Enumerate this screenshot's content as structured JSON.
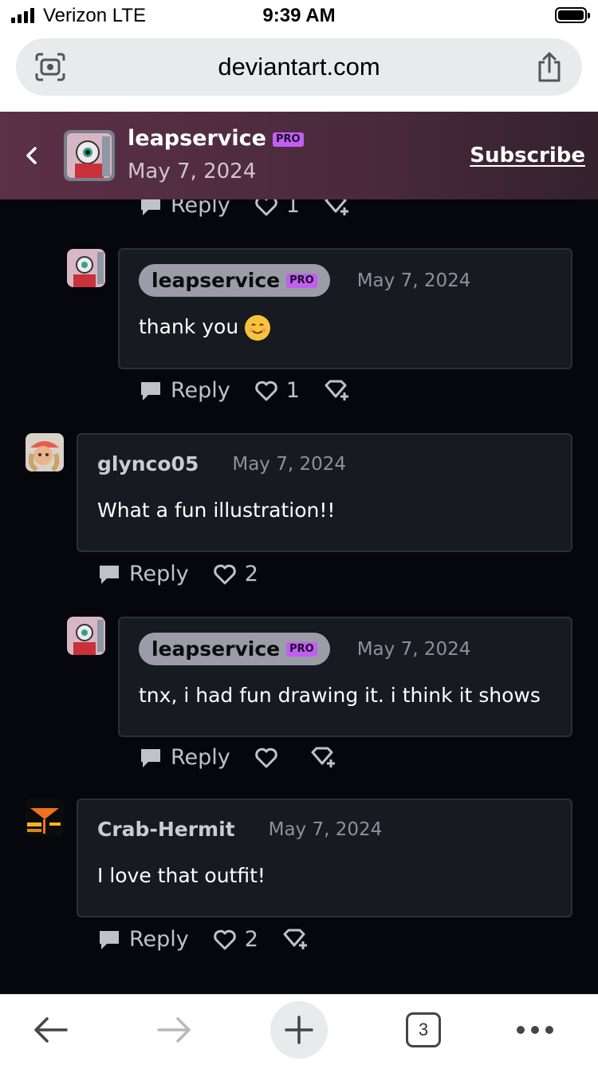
{
  "status_bar": {
    "carrier": "Verizon  LTE",
    "time": "9:39 AM"
  },
  "address_bar": {
    "url": "deviantart.com"
  },
  "deviation_header": {
    "username": "leapservice",
    "badge": "PRO",
    "date": "May 7, 2024",
    "subscribe_label": "Subscribe"
  },
  "top_actions": {
    "reply": "Reply",
    "likes": "1"
  },
  "comments": [
    {
      "username": "leapservice",
      "badge": "PRO",
      "date": "May 7, 2024",
      "text": "thank you",
      "reply": "Reply",
      "likes": "1"
    },
    {
      "username": "glynco05",
      "date": "May 7, 2024",
      "text": "What a fun illustration!!",
      "reply": "Reply",
      "likes": "2"
    },
    {
      "username": "leapservice",
      "badge": "PRO",
      "date": "May 7, 2024",
      "text": "tnx, i had fun drawing it. i think it shows",
      "reply": "Reply",
      "likes": ""
    },
    {
      "username": "Crab-Hermit",
      "date": "May 7, 2024",
      "text": "I love that outfit!",
      "reply": "Reply",
      "likes": "2"
    }
  ],
  "toolbar": {
    "tab_count": "3"
  },
  "colors": {
    "pro_badge": "#c15ff2",
    "header_bg": "#5c3047",
    "card_bg": "#171a20"
  }
}
